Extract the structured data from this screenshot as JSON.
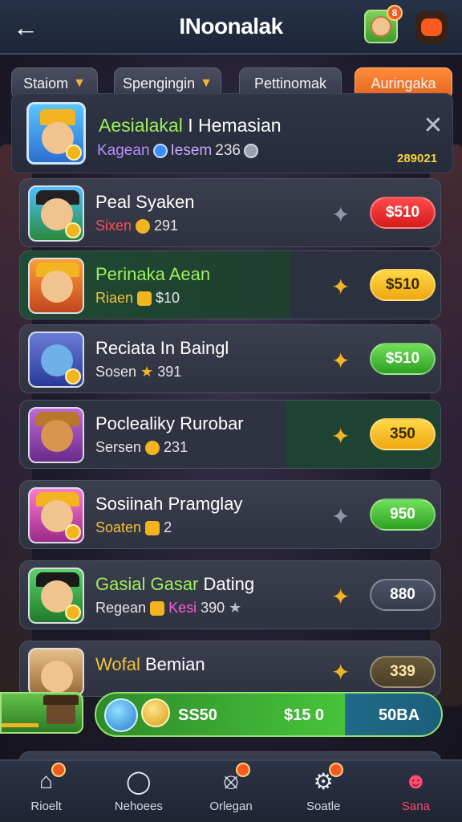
{
  "header": {
    "title": "INoonalak",
    "back_icon": "arrow-left-icon",
    "avatar_badge": "8"
  },
  "filters": [
    {
      "label": "Staiom",
      "icon": "chevron-down-icon"
    },
    {
      "label": "Spengingin",
      "icon": "chevron-down-icon"
    },
    {
      "label": "Pettinomak",
      "icon": ""
    },
    {
      "label": "Auringaka",
      "icon": ""
    }
  ],
  "featured": {
    "name_green": "Aesialakal",
    "name_rest": "I Hemasian",
    "sub_left": "Kagean",
    "sub_mid": "Iesem",
    "sub_num": "236",
    "score": "289021"
  },
  "rows": [
    {
      "name": "Peal Syaken",
      "sub_label": "Sixen",
      "sub_value": "291",
      "price": "$510",
      "star": "grey",
      "pill": "red",
      "sub_color": "#ff4a5a"
    },
    {
      "name": "Perinaka Aean",
      "sub_label": "Riaen",
      "sub_value": "$10",
      "price": "$510",
      "star": "gold",
      "pill": "yellow",
      "sub_color": "#f5c23a",
      "name_color": "#9ef05b"
    },
    {
      "name": "Reciata In Baingl",
      "sub_label": "Sosen",
      "sub_value": "391",
      "price": "$510",
      "star": "gold",
      "pill": "green",
      "sub_color": "#d8dce6"
    },
    {
      "name": "Poclealiky Rurobar",
      "sub_label": "Sersen",
      "sub_value": "231",
      "price": "350",
      "star": "gold",
      "pill": "yellow",
      "sub_color": "#d8dce6"
    },
    {
      "name": "Sosiinah Pramglay",
      "sub_label": "Soaten",
      "sub_value": "2",
      "price": "950",
      "star": "grey",
      "pill": "green",
      "sub_color": "#f5c23a"
    },
    {
      "name_green": "Gasial Gasar",
      "name": "Dating",
      "sub_label": "Regean",
      "sub_mid": "Kesi",
      "sub_value": "390",
      "price": "880",
      "star": "gold",
      "pill": "slate",
      "sub_color": "#d8dce6"
    },
    {
      "name_gold": "Wofal",
      "name": "Bemian",
      "sub_label": "",
      "sub_value": "",
      "price": "339",
      "star": "gold",
      "pill": "brown",
      "sub_color": "#d8dce6"
    }
  ],
  "progress": {
    "t1": "SS50",
    "t2": "$15 0",
    "t3": "50BA",
    "fill": 0.72
  },
  "nav": [
    {
      "label": "Rioelt",
      "icon": "home-icon",
      "badge": true,
      "active": false
    },
    {
      "label": "Nehoees",
      "icon": "chat-icon",
      "badge": false,
      "active": false
    },
    {
      "label": "Orlegan",
      "icon": "compass-icon",
      "badge": true,
      "active": false
    },
    {
      "label": "Soatle",
      "icon": "gear-icon",
      "badge": true,
      "active": false
    },
    {
      "label": "Sana",
      "icon": "profile-icon",
      "badge": false,
      "active": true
    }
  ]
}
